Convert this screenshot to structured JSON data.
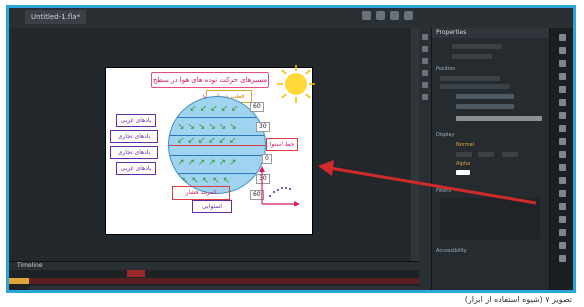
{
  "window": {
    "doc_tab": "Untitled-1.fla*",
    "panel_tab": "Properties"
  },
  "stage_slide": {
    "title": "مسیرهای حرکت توده های هوا در سطح زمین",
    "boxes": [
      "قطب شمال",
      "بادهای غربی",
      "بادهای تجاری",
      "بادهای تجاری",
      "بادهای غربی",
      "خط استوا",
      "استوایی"
    ],
    "latitudes": [
      "60",
      "30",
      "0",
      "30",
      "60"
    ],
    "bottom_label": "کمربند فشار"
  },
  "timeline": {
    "label": "Timeline"
  },
  "properties": {
    "sections": [
      "Position",
      "Display",
      "Filters",
      "Accessibility"
    ],
    "highlight_values": [
      "Normal",
      "Alpha"
    ]
  },
  "caption": "تصویر ۷ (شیوه استفاده از ابزار)",
  "colors": {
    "frame_border": "#2aa6d8",
    "app_bg": "#1b1f22",
    "arrow": "#d22a2a",
    "accent_orange": "#e0a23a"
  }
}
